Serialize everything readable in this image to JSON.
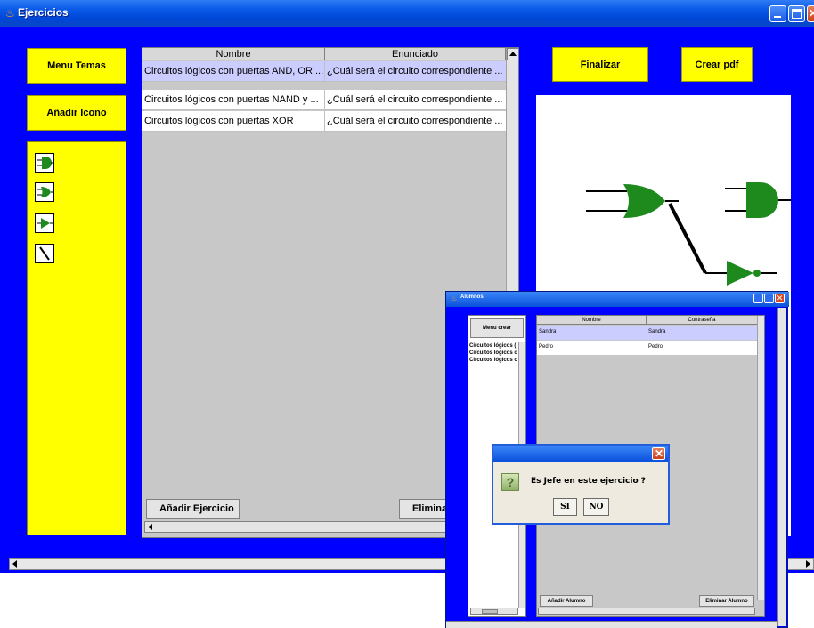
{
  "window": {
    "title": "Ejercicios",
    "buttons": {
      "menu_temas": "Menu Temas",
      "anadir_icono": "Añadir Icono",
      "finalizar": "Finalizar",
      "crear_pdf": "Crear pdf"
    }
  },
  "table": {
    "columns": [
      "Nombre",
      "Enunciado"
    ],
    "rows": [
      {
        "nombre": "Circuitos lógicos con puertas AND, OR ...",
        "enunciado": "¿Cuál será el circuito correspondiente ..."
      },
      {
        "nombre": "Circuitos lógicos con puertas NAND y ...",
        "enunciado": "¿Cuál será el circuito correspondiente ..."
      },
      {
        "nombre": "Circuitos lógicos con puertas XOR",
        "enunciado": "¿Cuál será el circuito correspondiente ..."
      }
    ],
    "add_button": "Añadir Ejercicio",
    "delete_button": "Elimina"
  },
  "palette": {
    "icons": [
      "and-gate-icon",
      "or-gate-icon",
      "buffer-gate-icon",
      "wire-icon"
    ]
  },
  "alumnos_window": {
    "title": "Alumnos",
    "menu_button": "Menu crear",
    "list_items": [
      "Circuitos lógicos (",
      "Circuitos lógicos c",
      "Circuitos lógicos c"
    ],
    "columns": [
      "Nombre",
      "Contraseña"
    ],
    "rows": [
      {
        "nombre": "Sandra",
        "contrasena": "Sandra"
      },
      {
        "nombre": "Pedro",
        "contrasena": "Pedro"
      }
    ],
    "add_button": "Añadir Alumno",
    "delete_button": "Eliminar Alumno"
  },
  "dialog": {
    "message": "Es Jefe en este ejercicio ?",
    "yes": "SI",
    "no": "NO"
  },
  "colors": {
    "background": "#0000ff",
    "button": "#ffff00",
    "gate": "#1e8a1e",
    "selected_row": "#cccdff"
  }
}
